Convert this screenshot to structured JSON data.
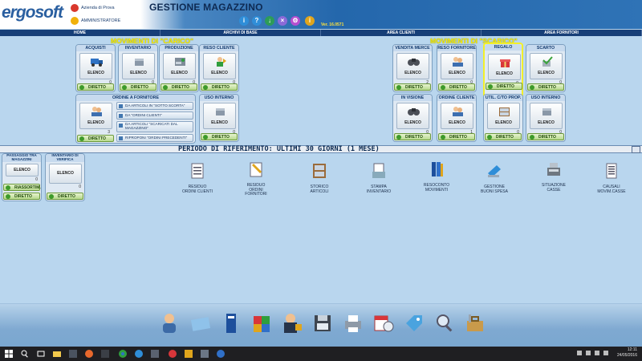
{
  "header": {
    "logo_main": "ergosoft",
    "company": "Azienda di Prova",
    "user": "AMMINISTRATORE",
    "title": "GESTIONE MAGAZZINO",
    "version": "Ver. 16.0571",
    "toolbar_icons": [
      "info-icon",
      "help-icon",
      "download-icon",
      "close-icon",
      "settings-icon",
      "info-i-icon"
    ]
  },
  "tabs": [
    "HOME",
    "ARCHIVI DI BASE",
    "AREA CLIENTI",
    "AREA FORNITORI"
  ],
  "sections": {
    "carico": "MOVIMENTI DI \"CARICO\"",
    "scarico": "MOVIMENTI DI \"SCARICO\""
  },
  "labels": {
    "elenco": "ELENCO",
    "diretto": "DIRETTO",
    "riassortim": "RIASSORTIM."
  },
  "carico_panels": [
    {
      "title": "ACQUISTI",
      "count": "0"
    },
    {
      "title": "INVENTARIO",
      "count": "0"
    },
    {
      "title": "PRODUZIONE",
      "count": "0"
    },
    {
      "title": "RESO CLIENTE",
      "count": "0"
    }
  ],
  "ordine": {
    "title": "ORDINE A FORNITORE",
    "count": "3",
    "rows": [
      "DA ARTICOLI IN \"SOTTO SCORTA\"",
      "DA \"ORDINI CLIENTI\"",
      "DA ARTICOLI \"SCARICATI DAL MAGAZZINO\"",
      "RIPROPONI \"ORDINI PRECEDENTI\""
    ]
  },
  "uso_interno_carico": {
    "title": "USO INTERNO",
    "count": "0"
  },
  "scarico_panels": [
    {
      "title": "VENDITA MERCE",
      "count": "2"
    },
    {
      "title": "RESO FORNITORE",
      "count": "0"
    },
    {
      "title": "REGALO",
      "count": "0"
    },
    {
      "title": "SCARTO",
      "count": "0"
    }
  ],
  "scarico_panels_row2": [
    {
      "title": "IN VISIONE",
      "count": "0"
    },
    {
      "title": "ORDINE CLIENTE",
      "count": "1"
    },
    {
      "title": "UTIL. C/TO PROP.",
      "count": "0"
    },
    {
      "title": "USO INTERNO",
      "count": "0"
    }
  ],
  "period": "PERIODO DI RIFERIMENTO: ULTIMI 30 GIORNI (1 MESE)",
  "left_panels": [
    {
      "title": "PASSAGGIO TRA MAGAZZINI",
      "count": "0"
    },
    {
      "title": "INVENTARIO DI VERIFICA",
      "count": "0"
    }
  ],
  "report_icons": [
    {
      "label": "RESIDUO\nORDINI CLIENTI",
      "icon": "document-list-icon"
    },
    {
      "label": "RESIDUO\nORDINI\nFORNITORI",
      "icon": "document-pencil-icon"
    },
    {
      "label": "STORICO\nARTICOLI",
      "icon": "shelf-icon"
    },
    {
      "label": "STAMPA\nINVENTARIO",
      "icon": "print-document-icon"
    },
    {
      "label": "RESOCONTO\nMOVIMENTI",
      "icon": "binders-icon"
    },
    {
      "label": "GESTIONE\nBUONI SPESA",
      "icon": "voucher-icon"
    },
    {
      "label": "SITUAZIONE\nCASSE",
      "icon": "cash-register-icon"
    },
    {
      "label": "CAUSALI\nMOVIM.CASSE",
      "icon": "document-lines-icon"
    }
  ],
  "shelf_icons": [
    "person-icon",
    "card-icon",
    "binder-icon",
    "puzzle-icon",
    "police-lock-icon",
    "floppy-save-icon",
    "printer-icon",
    "calendar-clock-icon",
    "tag-icon",
    "magnifier-icon",
    "toolbox-icon"
  ],
  "taskbar": {
    "time": "12:11",
    "date": "24/05/2016"
  },
  "colors": {
    "accent_yellow": "#ffee00",
    "tabbar": "#173f78",
    "background": "#b9d6ee",
    "highlight_box": "#f2ef2a"
  }
}
